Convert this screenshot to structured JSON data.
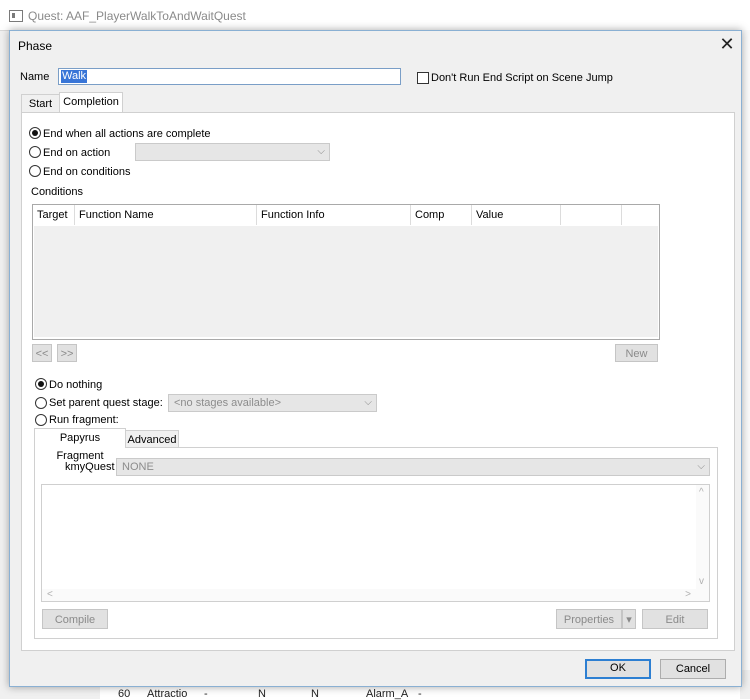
{
  "background_window": {
    "title": "Quest: AAF_PlayerWalkToAndWaitQuest",
    "partial_row": [
      "60",
      "Attractio",
      "-",
      "N",
      "N",
      "Alarm_A",
      "-"
    ]
  },
  "dialog": {
    "title": "Phase",
    "name_label": "Name",
    "name_value": "Walk",
    "dont_run_label": "Don't Run End Script on Scene Jump",
    "dont_run_checked": false,
    "tabs": [
      {
        "label": "Start",
        "active": false
      },
      {
        "label": "Completion",
        "active": true
      }
    ],
    "completion": {
      "end_all_label": "End when all actions are complete",
      "end_action_label": "End on action",
      "end_action_value": "",
      "end_conditions_label": "End on conditions",
      "selected_end_option": "End when all actions are complete",
      "conditions_label": "Conditions",
      "columns": [
        "Target",
        "Function Name",
        "Function Info",
        "Comp",
        "Value"
      ],
      "prev_label": "<<",
      "next_label": ">>",
      "new_label": "New"
    },
    "result": {
      "do_nothing_label": "Do nothing",
      "set_parent_label": "Set parent quest stage:",
      "stage_placeholder": "<no stages available>",
      "run_fragment_label": "Run fragment:",
      "selected_option": "Do nothing"
    },
    "fragment_tabs": [
      {
        "label": "Papyrus Fragment",
        "active": true
      },
      {
        "label": "Advanced",
        "active": false
      }
    ],
    "fragment": {
      "quest_label": "kmyQuest",
      "quest_value": "NONE",
      "compile_label": "Compile",
      "properties_label": "Properties",
      "edit_label": "Edit"
    },
    "ok_label": "OK",
    "cancel_label": "Cancel"
  }
}
